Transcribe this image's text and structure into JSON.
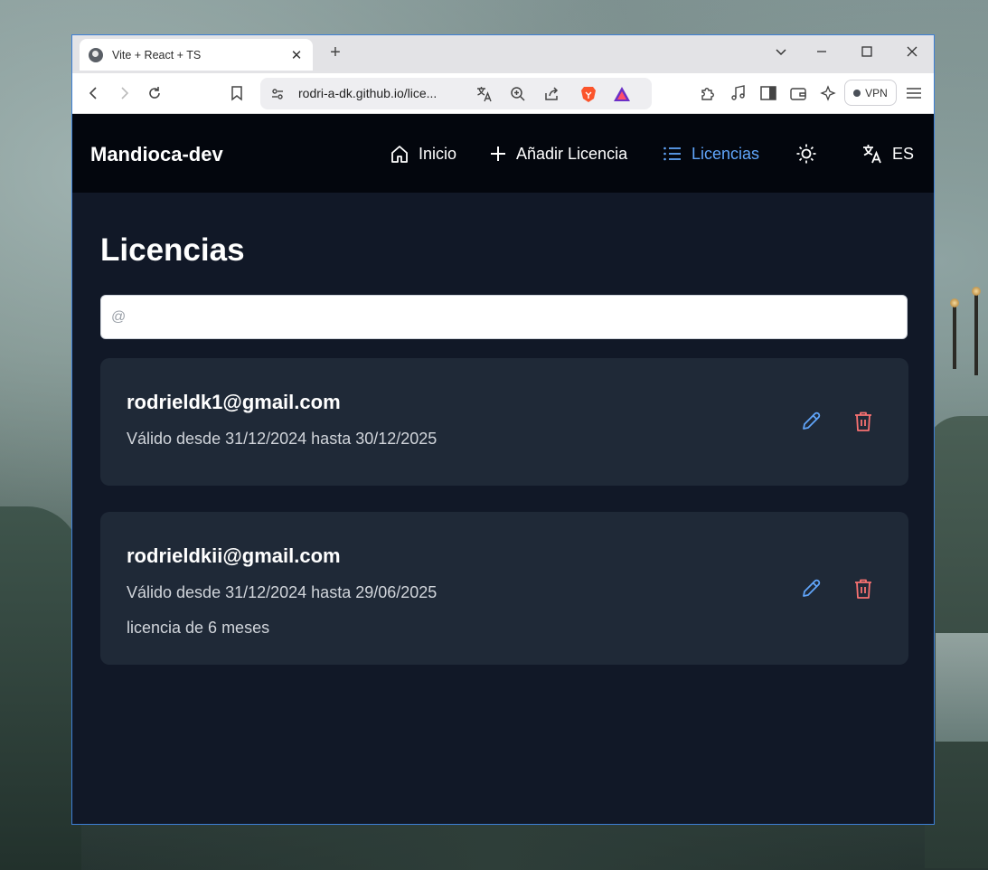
{
  "browser": {
    "tab_title": "Vite + React + TS",
    "tab_close": "✕",
    "new_tab": "+",
    "url": "rodri-a-dk.github.io/lice...",
    "vpn_label": "VPN"
  },
  "nav": {
    "brand": "Mandioca-dev",
    "items": [
      {
        "label": "Inicio",
        "icon": "home-icon"
      },
      {
        "label": "Añadir Licencia",
        "icon": "plus-icon"
      },
      {
        "label": "Licencias",
        "icon": "list-icon",
        "active": true
      }
    ],
    "theme_icon": "sun-icon",
    "language": "ES"
  },
  "page": {
    "title": "Licencias",
    "search_placeholder": "@"
  },
  "licenses": [
    {
      "email": "rodrieldk1@gmail.com",
      "validity": "Válido desde 31/12/2024 hasta 30/12/2025",
      "note": ""
    },
    {
      "email": "rodrieldkii@gmail.com",
      "validity": "Válido desde 31/12/2024 hasta 29/06/2025",
      "note": "licencia de 6 meses"
    }
  ],
  "colors": {
    "accent": "#60a5fa",
    "delete": "#f87171",
    "nav_bg": "#03060d",
    "content_bg": "#111827",
    "card_bg": "#1f2937"
  }
}
